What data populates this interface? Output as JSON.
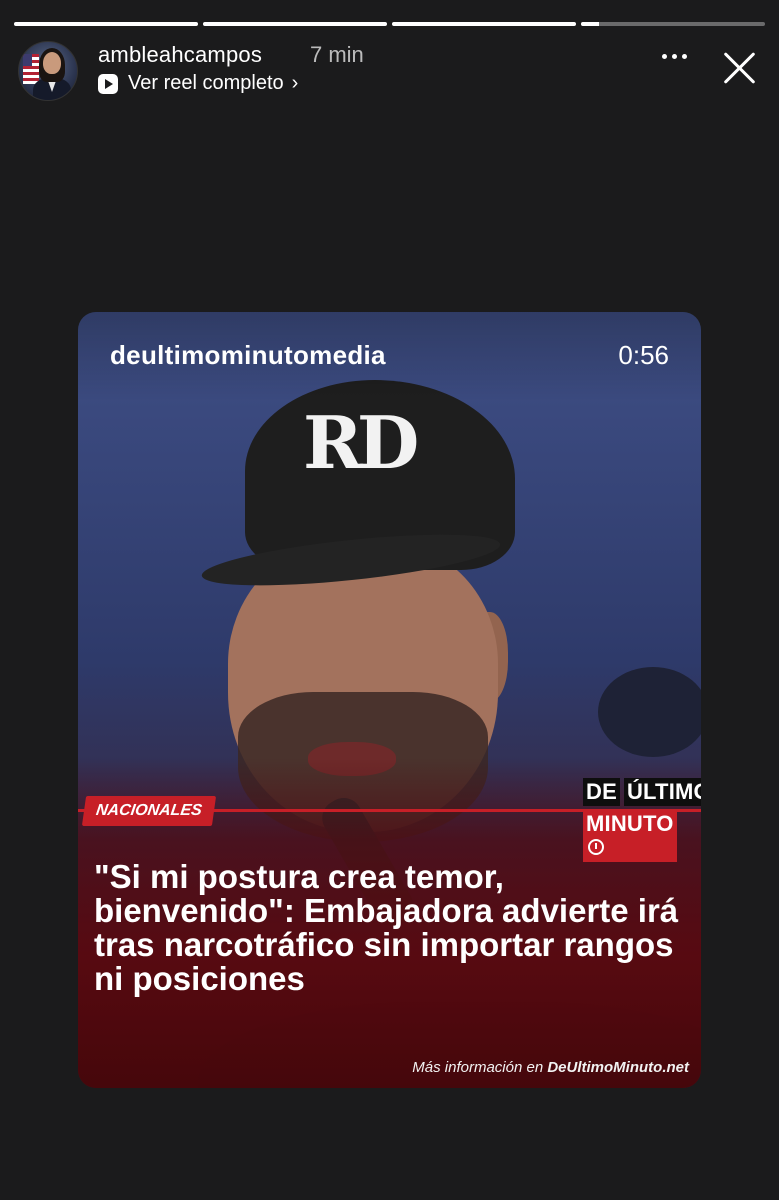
{
  "story": {
    "progress": [
      1.0,
      1.0,
      1.0,
      0.1
    ]
  },
  "header": {
    "username": "ambleahcampos",
    "time": "7 min",
    "reel_link": "Ver reel completo"
  },
  "reel": {
    "channel": "deultimominutomedia",
    "duration": "0:56",
    "brand": {
      "line1a": "DE",
      "line1b": "ÚLTIMO",
      "line2": "MINUTO"
    },
    "cap_logo": "RD",
    "category": "NACIONALES",
    "headline": "\"Si mi postura crea temor, bienvenido\": Embajadora advierte irá tras narcotráfico sin importar rangos ni posiciones",
    "footer_prefix": "Más información en",
    "footer_site": "DeUltimoMinuto.net"
  },
  "colors": {
    "background": "#1b1b1c",
    "brand_red": "#c71f27"
  },
  "icons": [
    "reel-icon",
    "chevron-right-icon",
    "more-icon",
    "close-icon"
  ]
}
